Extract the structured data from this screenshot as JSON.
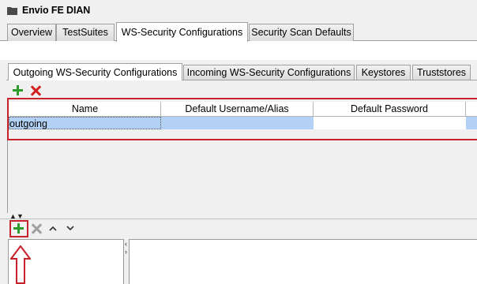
{
  "window": {
    "title": "Envio FE DIAN",
    "icon": "folder-icon"
  },
  "outer_tabs": [
    {
      "label": "Overview",
      "active": false
    },
    {
      "label": "TestSuites",
      "active": false
    },
    {
      "label": "WS-Security Configurations",
      "active": true
    },
    {
      "label": "Security Scan Defaults",
      "active": false
    }
  ],
  "inner_tabs": [
    {
      "label": "Outgoing WS-Security Configurations",
      "active": true
    },
    {
      "label": "Incoming WS-Security Configurations",
      "active": false
    },
    {
      "label": "Keystores",
      "active": false
    },
    {
      "label": "Truststores",
      "active": false
    }
  ],
  "toolbar": {
    "add_icon": "plus-icon",
    "remove_icon": "delete-icon"
  },
  "table": {
    "columns": [
      "Name",
      "Default Username/Alias",
      "Default Password"
    ],
    "rows": [
      {
        "name": "outgoing",
        "username": "",
        "password": ""
      }
    ]
  },
  "lower_toolbar": {
    "icons": [
      "plus-icon",
      "remove-icon",
      "move-up-icon",
      "move-down-icon"
    ]
  },
  "annotation": {
    "arrow_icon": "arrow-up-outline-icon",
    "highlight_color": "#c8222b"
  },
  "colors": {
    "selection": "#b3d1f5",
    "add_green": "#2c9b2c",
    "delete_red": "#d42020"
  }
}
